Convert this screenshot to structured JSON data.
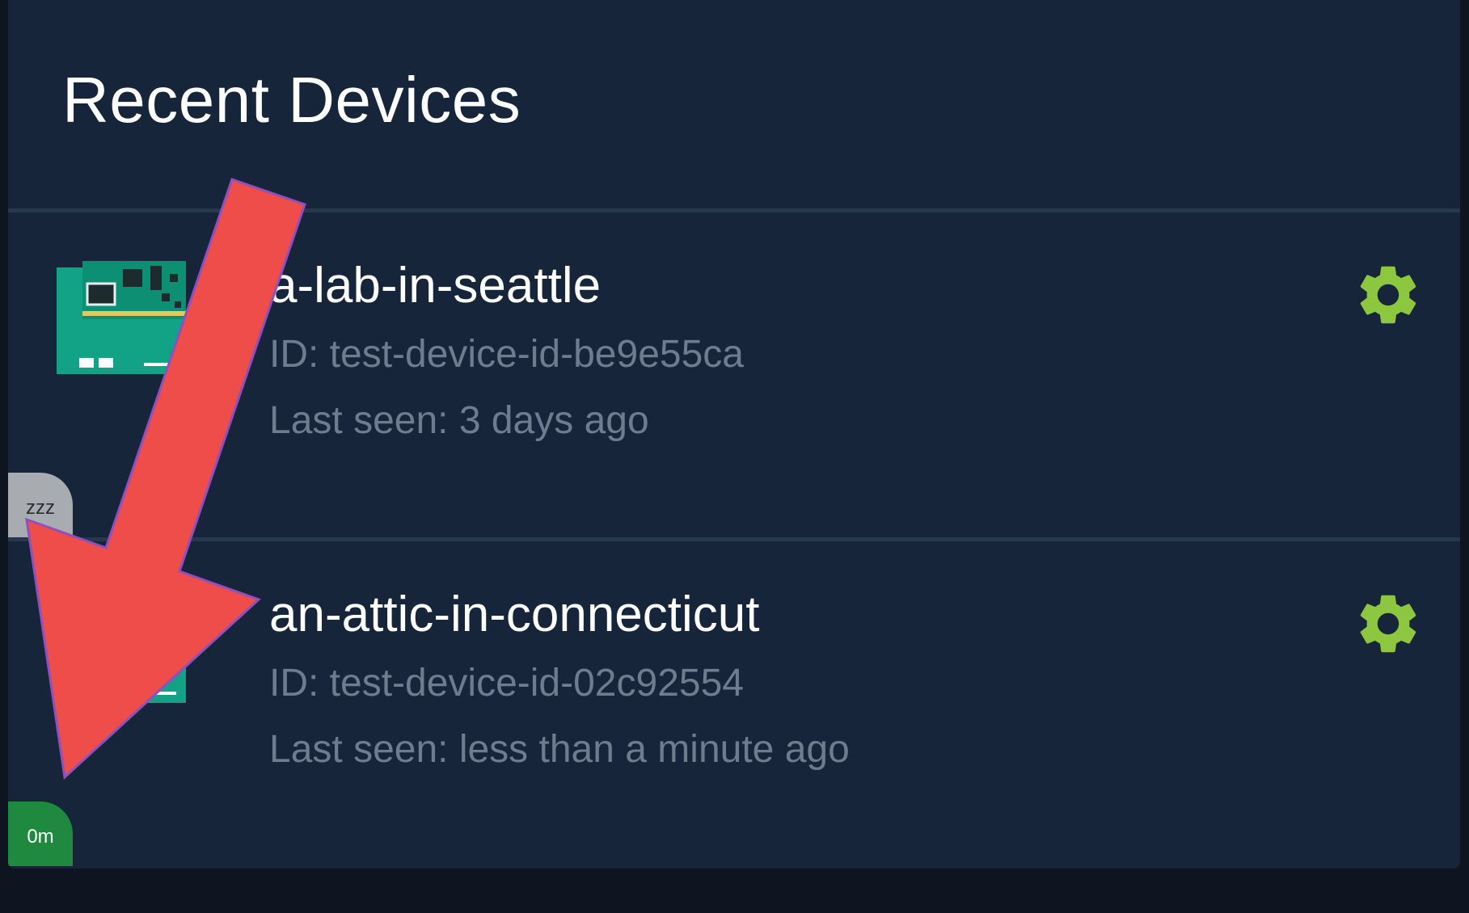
{
  "panel": {
    "title": "Recent Devices"
  },
  "devices": [
    {
      "name": "a-lab-in-seattle",
      "id": "ID: test-device-id-be9e55ca",
      "last_seen": "Last seen: 3 days ago",
      "status_badge": "zzz",
      "status": "sleeping"
    },
    {
      "name": "an-attic-in-connecticut",
      "id": "ID: test-device-id-02c92554",
      "last_seen": "Last seen: less than a minute ago",
      "status_badge": "0m",
      "status": "online"
    }
  ],
  "icons": {
    "settings": "gear-icon",
    "device": "circuit-board-icon",
    "annotation": "arrow-annotation"
  },
  "colors": {
    "background": "#0e1420",
    "panel": "#16253a",
    "divider": "#27384c",
    "text_primary": "#ffffff",
    "text_secondary": "#6e7d8e",
    "gear": "#8dc63f",
    "badge_sleep": "#a8abb0",
    "badge_online": "#1f8a3f",
    "annotation_arrow": "#ef4d4a",
    "annotation_outline": "#8e4fbf"
  }
}
